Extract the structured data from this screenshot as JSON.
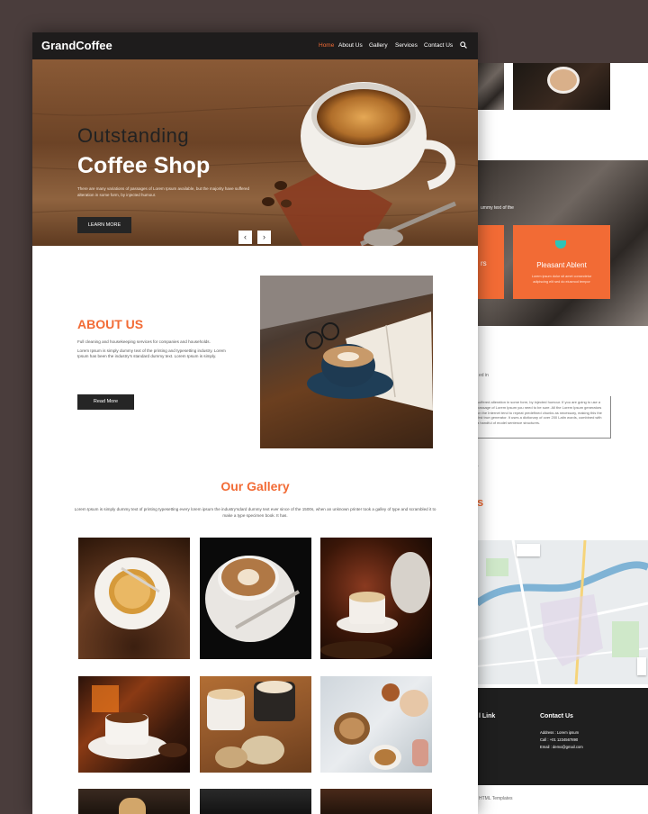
{
  "brand": "GrandCoffee",
  "nav": [
    "Home",
    "About Us",
    "Gallery",
    "Services",
    "Contact Us"
  ],
  "hero": {
    "subtitle": "Outstanding",
    "title": "Coffee Shop",
    "text": "There are many variations of passages of Lorem Ipsum available, but the majority have suffered alteration in some form, by injected humour.",
    "button": "LEARN MORE",
    "prev": "‹",
    "next": "›"
  },
  "about": {
    "title": "ABOUT US",
    "line1": "Full cleaning and housekeeping services for companies and households.",
    "line2": "Lorem Ipsum is simply dummy text of the printing and typesetting industry. Lorem Ipsum has been the industry's standard dummy text. Lorem Ipsum is simply.",
    "button": "Read More"
  },
  "gallery": {
    "title": "Our Gallery",
    "text": "Lorem Ipsum is simply dummy text of printing typesetting every lorem ipsum the industry'sdard dummy text ever since of the 1500s, when an unknown printer took a galley of type and scrambled it to make a type specimen book. It has."
  },
  "back": {
    "card_title": "Pleasant Ablent",
    "card_text": "Lorem ipsum dolor sit amet consectetur adipiscing elit sed do eiusmod tempor",
    "left_card_fragment": "rs",
    "photo_caption": "ummy text of the",
    "side_text": "ed in",
    "quote_text": "suffered alteration in some form, by injected humour. If you are going to use a passage of Lorem Ipsum you need to be sure. All the Lorem Ipsum generators on the Internet tend to repeat predefined chunks as necessary, making this the first true generator. It uses a dictionary of over 200 Latin words, combined with a handful of model sentence structures.",
    "small_r": "r",
    "orange_s": "s",
    "footer_link": "l Link",
    "contact_title": "Contact Us",
    "address": "Address : Lorem ipsum",
    "call": "Call : +01 1234567890",
    "email": "Email : demo@gmail.com",
    "copyright": "HTML Templates"
  },
  "colors": {
    "accent": "#f26b35",
    "dark": "#1e1c1c"
  }
}
